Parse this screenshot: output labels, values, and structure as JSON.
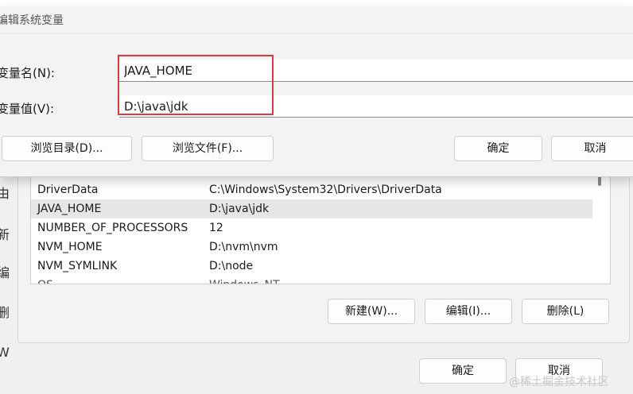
{
  "dialog": {
    "title": "编辑系统变量",
    "name_label": "变量名(N):",
    "name_value": "JAVA_HOME",
    "value_label": "变量值(V):",
    "value_value": "D:\\java\\jdk",
    "buttons": {
      "browse_dir": "浏览目录(D)...",
      "browse_file": "浏览文件(F)...",
      "ok": "确定",
      "cancel": "取消"
    }
  },
  "background": {
    "side_glyphs": [
      "由",
      "新",
      "编",
      "删",
      "W"
    ],
    "list_rows": [
      {
        "name": "DriverData",
        "value": "C:\\Windows\\System32\\Drivers\\DriverData",
        "selected": false
      },
      {
        "name": "JAVA_HOME",
        "value": "D:\\java\\jdk",
        "selected": true
      },
      {
        "name": "NUMBER_OF_PROCESSORS",
        "value": "12",
        "selected": false
      },
      {
        "name": "NVM_HOME",
        "value": "D:\\nvm\\nvm",
        "selected": false
      },
      {
        "name": "NVM_SYMLINK",
        "value": "D:\\node",
        "selected": false
      },
      {
        "name": "OS",
        "value": "Windows_NT",
        "selected": false
      }
    ],
    "list_buttons": {
      "new": "新建(W)...",
      "edit": "编辑(I)...",
      "delete": "删除(L)"
    },
    "window_buttons": {
      "ok": "确定",
      "cancel": "取消"
    }
  },
  "watermark": "@稀土掘金技术社区",
  "colors": {
    "highlight": "#e0383e",
    "selected_row": "#e6e6e6"
  }
}
